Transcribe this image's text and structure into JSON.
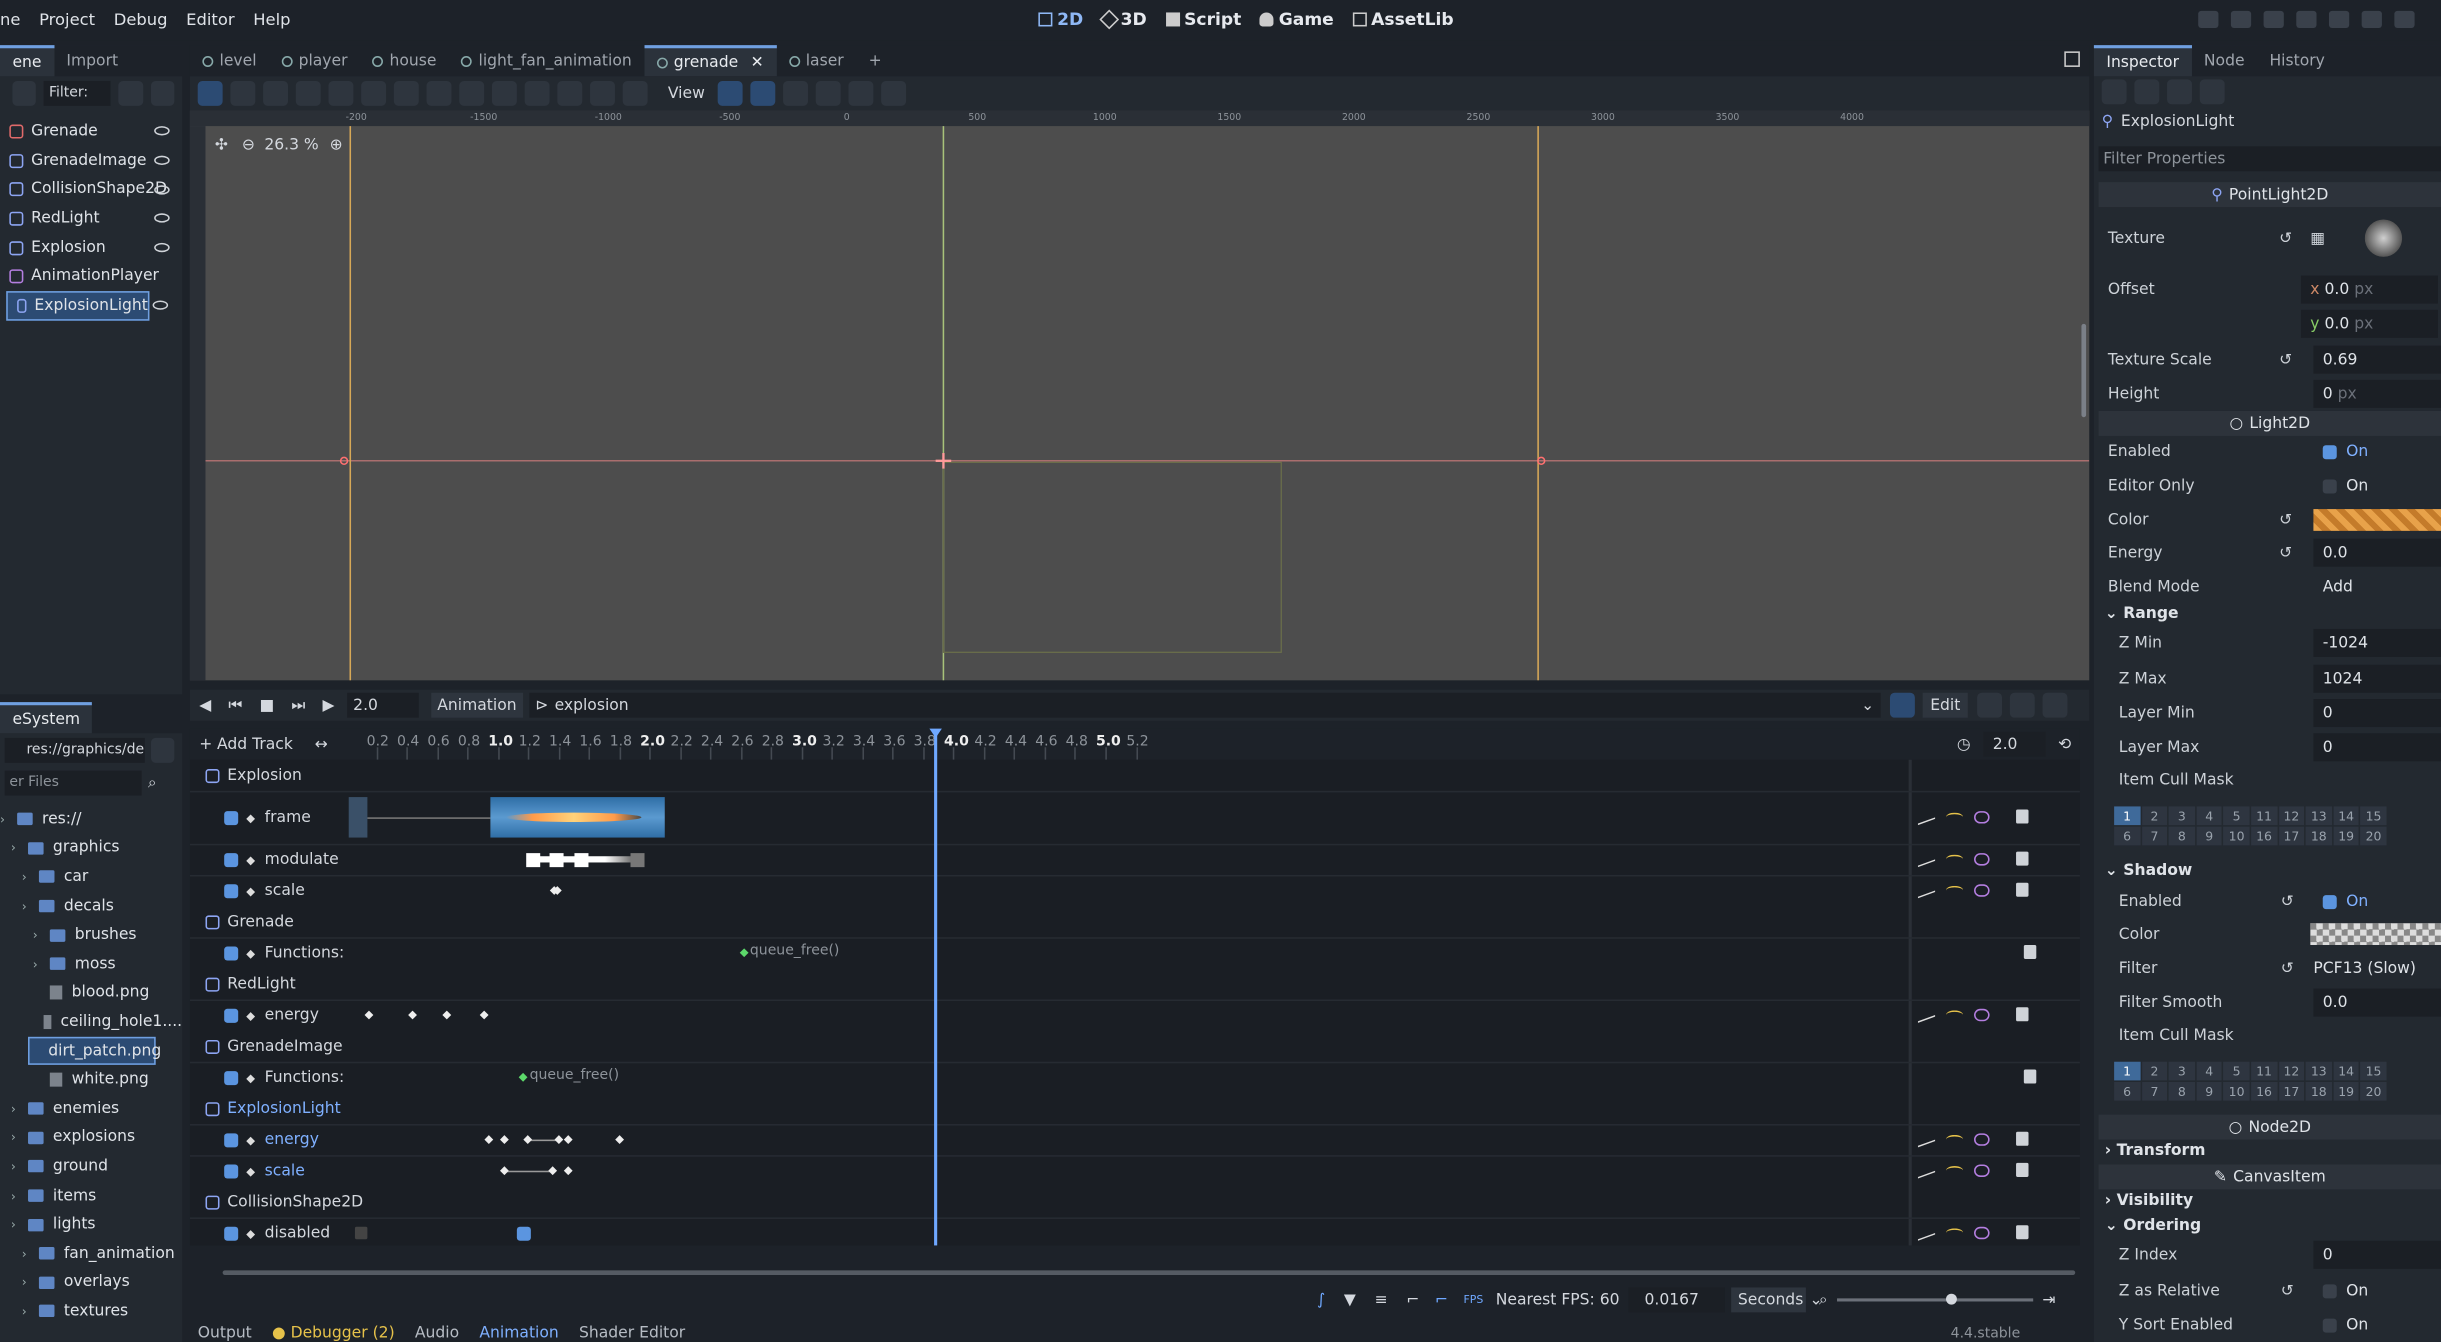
{
  "menu": [
    "ne",
    "Project",
    "Debug",
    "Editor",
    "Help"
  ],
  "modes": [
    "2D",
    "3D",
    "Script",
    "Game",
    "AssetLib"
  ],
  "scene_dock": {
    "tabs": [
      "ene",
      "Import"
    ],
    "filter_label": "Filter:",
    "nodes": [
      {
        "name": "Grenade",
        "color": "#e06a6a"
      },
      {
        "name": "GrenadeImage",
        "color": "#8da5f3"
      },
      {
        "name": "CollisionShape2D",
        "color": "#8da5f3"
      },
      {
        "name": "RedLight",
        "color": "#8da5f3"
      },
      {
        "name": "Explosion",
        "color": "#8da5f3"
      },
      {
        "name": "AnimationPlayer",
        "color": "#b47ee0"
      },
      {
        "name": "ExplosionLight",
        "color": "#8da5f3"
      }
    ]
  },
  "filesystem": {
    "tab": "eSystem",
    "path": "res://graphics/de",
    "filter_placeholder": "er Files",
    "items": [
      {
        "label": "res://",
        "depth": 0,
        "type": "folder"
      },
      {
        "label": "graphics",
        "depth": 1,
        "type": "folder"
      },
      {
        "label": "car",
        "depth": 2,
        "type": "folder"
      },
      {
        "label": "decals",
        "depth": 2,
        "type": "folder"
      },
      {
        "label": "brushes",
        "depth": 3,
        "type": "folder"
      },
      {
        "label": "moss",
        "depth": 3,
        "type": "folder"
      },
      {
        "label": "blood.png",
        "depth": 3,
        "type": "file"
      },
      {
        "label": "ceiling_hole1....",
        "depth": 3,
        "type": "file"
      },
      {
        "label": "dirt_patch.png",
        "depth": 3,
        "type": "file"
      },
      {
        "label": "white.png",
        "depth": 3,
        "type": "file"
      },
      {
        "label": "enemies",
        "depth": 1,
        "type": "folder"
      },
      {
        "label": "explosions",
        "depth": 1,
        "type": "folder"
      },
      {
        "label": "ground",
        "depth": 1,
        "type": "folder"
      },
      {
        "label": "items",
        "depth": 1,
        "type": "folder"
      },
      {
        "label": "lights",
        "depth": 1,
        "type": "folder"
      },
      {
        "label": "fan_animation",
        "depth": 2,
        "type": "folder"
      },
      {
        "label": "overlays",
        "depth": 2,
        "type": "folder"
      },
      {
        "label": "textures",
        "depth": 2,
        "type": "folder"
      }
    ]
  },
  "scene_tabs": [
    "level",
    "player",
    "house",
    "light_fan_animation",
    "grenade",
    "laser"
  ],
  "viewport": {
    "view_label": "View",
    "zoom": "26.3 %",
    "ruler_ticks": [
      "-200",
      "-1500",
      "-1000",
      "-500",
      "0",
      "500",
      "1000",
      "1500",
      "2000",
      "2500",
      "3000",
      "3500",
      "4000"
    ]
  },
  "animation": {
    "time": "2.0",
    "anim_label": "Animation",
    "anim_name": "explosion",
    "edit_label": "Edit",
    "add_track": "Add Track",
    "length": "2.0",
    "ticks": [
      "0.2",
      "0.4",
      "0.6",
      "0.8",
      "1.0",
      "1.2",
      "1.4",
      "1.6",
      "1.8",
      "2.0",
      "2.2",
      "2.4",
      "2.6",
      "2.8",
      "3.0",
      "3.2",
      "3.4",
      "3.6",
      "3.8",
      "4.0",
      "4.2",
      "4.4",
      "4.6",
      "4.8",
      "5.0",
      "5.2"
    ],
    "groups": [
      {
        "name": "Explosion",
        "tracks": [
          "frame",
          "modulate",
          "scale"
        ]
      },
      {
        "name": "Grenade",
        "tracks": [
          "Functions:"
        ]
      },
      {
        "name": "RedLight",
        "tracks": [
          "energy"
        ]
      },
      {
        "name": "GrenadeImage",
        "tracks": [
          "Functions:"
        ]
      },
      {
        "name": "ExplosionLight",
        "tracks": [
          "energy",
          "scale"
        ]
      },
      {
        "name": "CollisionShape2D",
        "tracks": [
          "disabled"
        ]
      }
    ],
    "method_keys": [
      "queue_free()",
      "queue_free()"
    ],
    "snap_label": "Nearest FPS: 60",
    "step": "0.0167",
    "unit": "Seconds"
  },
  "bottom_tabs": [
    "Output",
    "Debugger (2)",
    "Audio",
    "Animation",
    "Shader Editor"
  ],
  "version": "4.4.stable",
  "inspector": {
    "tabs": [
      "Inspector",
      "Node",
      "History"
    ],
    "node_name": "ExplosionLight",
    "filter_placeholder": "Filter Properties",
    "class1": "PointLight2D",
    "class2": "Light2D",
    "class3": "Node2D",
    "class4": "CanvasItem",
    "props": {
      "texture": "Texture",
      "offset": "Offset",
      "offset_x": "0.0",
      "offset_y": "0.0",
      "px": "px",
      "texture_scale": "Texture Scale",
      "texture_scale_v": "0.69",
      "height": "Height",
      "height_v": "0",
      "enabled": "Enabled",
      "editor_only": "Editor Only",
      "on": "On",
      "color": "Color",
      "energy": "Energy",
      "energy_v": "0.0",
      "blend_mode": "Blend Mode",
      "blend_v": "Add",
      "range": "Range",
      "zmin": "Z Min",
      "zmin_v": "-1024",
      "zmax": "Z Max",
      "zmax_v": "1024",
      "layer_min": "Layer Min",
      "layer_min_v": "0",
      "layer_max": "Layer Max",
      "layer_max_v": "0",
      "item_cull": "Item Cull Mask",
      "shadow": "Shadow",
      "filter": "Filter",
      "filter_v": "PCF13 (Slow)",
      "filter_smooth": "Filter Smooth",
      "filter_smooth_v": "0.0",
      "transform": "Transform",
      "visibility": "Visibility",
      "ordering": "Ordering",
      "zindex": "Z Index",
      "zindex_v": "0",
      "z_rel": "Z as Relative",
      "ysort": "Y Sort Enabled"
    },
    "mask_numbers": [
      "1",
      "2",
      "3",
      "4",
      "5",
      "11",
      "12",
      "13",
      "14",
      "15",
      "6",
      "7",
      "8",
      "9",
      "10",
      "16",
      "17",
      "18",
      "19",
      "20"
    ]
  }
}
